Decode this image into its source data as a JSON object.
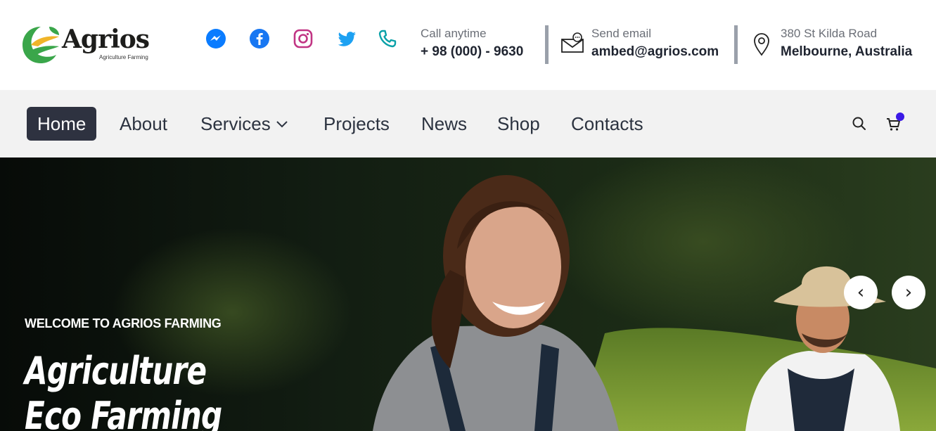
{
  "brand": {
    "name": "Agrios",
    "tagline": "Agriculture Farming"
  },
  "social": [
    {
      "icon": "messenger-icon",
      "color": "#0a7cff"
    },
    {
      "icon": "facebook-icon",
      "color": "#1877f2"
    },
    {
      "icon": "instagram-icon",
      "color": "#c13584"
    },
    {
      "icon": "twitter-icon",
      "color": "#1da1f2"
    },
    {
      "icon": "phone-icon",
      "color": "#0aa1a8"
    }
  ],
  "contact": {
    "call_label": "Call anytime",
    "call_value": "+ 98 (000) - 9630",
    "email_label": "Send email",
    "email_value": "ambed@agrios.com",
    "address_label": "380 St Kilda Road",
    "address_value": "Melbourne, Australia"
  },
  "nav": {
    "items": [
      {
        "label": "Home",
        "active": true
      },
      {
        "label": "About"
      },
      {
        "label": "Services",
        "has_dropdown": true
      },
      {
        "label": "Projects"
      },
      {
        "label": "News"
      },
      {
        "label": "Shop"
      },
      {
        "label": "Contacts"
      }
    ],
    "search_icon": "search-icon",
    "cart_icon": "cart-icon",
    "cart_badge_color": "#3b19e6"
  },
  "hero": {
    "kicker": "WELCOME TO AGRIOS FARMING",
    "title": "Agriculture Eco Farming",
    "prev_label": "‹",
    "next_label": "›"
  },
  "colors": {
    "nav_active_bg": "#2e3240",
    "nav_bg": "#f2f2f2"
  }
}
